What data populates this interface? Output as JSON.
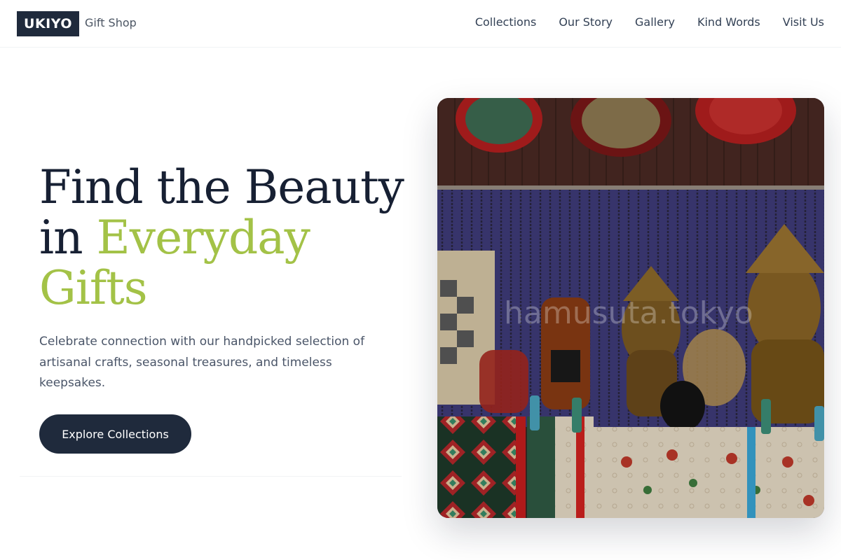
{
  "header": {
    "logo_text": "UKIYO",
    "logo_subtitle": "Gift Shop",
    "nav": [
      {
        "label": "Collections"
      },
      {
        "label": "Our Story"
      },
      {
        "label": "Gallery"
      },
      {
        "label": "Kind Words"
      },
      {
        "label": "Visit Us"
      }
    ]
  },
  "hero": {
    "title_line1": "Find the Beauty",
    "title_line2_prefix": "in ",
    "title_accent": "Everyday Gifts",
    "subtitle": "Celebrate connection with our handpicked selection of artisanal crafts, seasonal treasures, and timeless keepsakes.",
    "cta_label": "Explore Collections",
    "image_watermark": "hamusuta.tokyo"
  },
  "colors": {
    "brand_dark": "#1f2a3c",
    "accent_green": "#a3c247"
  }
}
